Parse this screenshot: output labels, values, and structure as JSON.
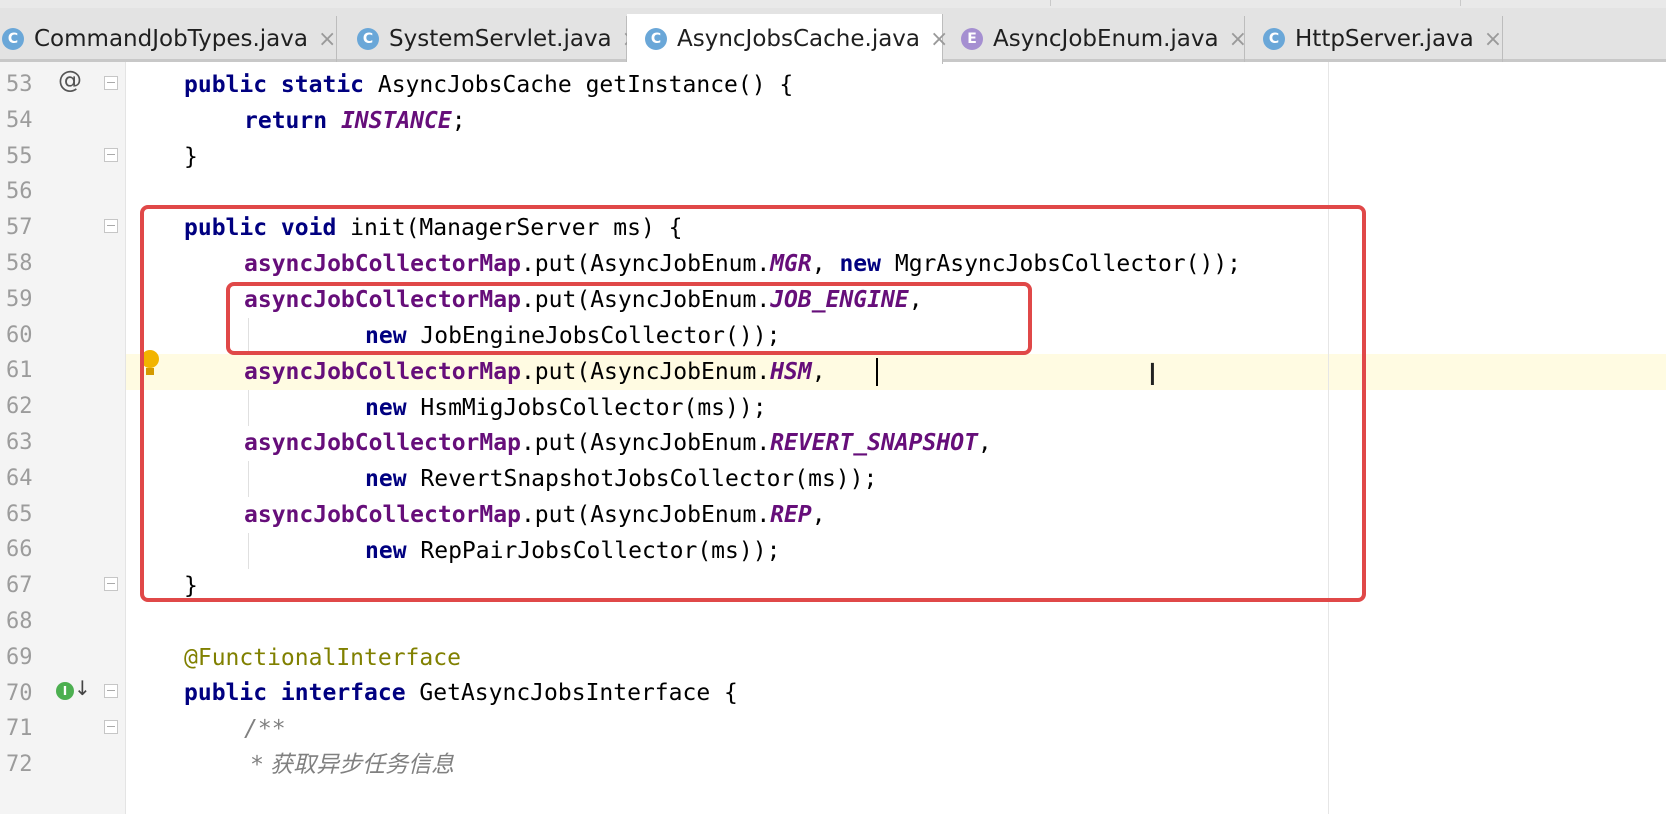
{
  "tabs": [
    {
      "label": "CommandJobTypes.java",
      "icon": "C",
      "active": false
    },
    {
      "label": "SystemServlet.java",
      "icon": "C",
      "active": false
    },
    {
      "label": "AsyncJobsCache.java",
      "icon": "C",
      "active": true
    },
    {
      "label": "AsyncJobEnum.java",
      "icon": "E",
      "active": false
    },
    {
      "label": "HttpServer.java",
      "icon": "C",
      "active": false
    }
  ],
  "tab_close_glyph": "×",
  "line_numbers": [
    "53",
    "54",
    "55",
    "56",
    "57",
    "58",
    "59",
    "60",
    "61",
    "62",
    "63",
    "64",
    "65",
    "66",
    "67",
    "68",
    "69",
    "70",
    "71",
    "72"
  ],
  "gutter_icons": {
    "override": "@",
    "implemented": "I",
    "implemented_arrow": "↓"
  },
  "code": {
    "l53": {
      "kw1": "public static",
      "rest": " AsyncJobsCache getInstance() {"
    },
    "l54": {
      "kw": "return",
      "sp": " ",
      "enum": "INSTANCE",
      "rest": ";"
    },
    "l55": {
      "text": "}"
    },
    "l57": {
      "kw1": "public void",
      "rest": " init(ManagerServer ms) {"
    },
    "l58": {
      "fld": "asyncJobCollectorMap",
      "a": ".put(AsyncJobEnum.",
      "enum": "MGR",
      "b": ", ",
      "kw": "new",
      "c": " MgrAsyncJobsCollector());"
    },
    "l59": {
      "fld": "asyncJobCollectorMap",
      "a": ".put(AsyncJobEnum.",
      "enum": "JOB_ENGINE",
      "b": ","
    },
    "l60": {
      "kw": "new",
      "c": " JobEngineJobsCollector());"
    },
    "l61": {
      "fld": "asyncJobCollectorMap",
      "a": ".put(AsyncJobEnum.",
      "enum": "HSM",
      "b": ","
    },
    "l62": {
      "kw": "new",
      "c": " HsmMigJobsCollector(ms));"
    },
    "l63": {
      "fld": "asyncJobCollectorMap",
      "a": ".put(AsyncJobEnum.",
      "enum": "REVERT_SNAPSHOT",
      "b": ","
    },
    "l64": {
      "kw": "new",
      "c": " RevertSnapshotJobsCollector(ms));"
    },
    "l65": {
      "fld": "asyncJobCollectorMap",
      "a": ".put(AsyncJobEnum.",
      "enum": "REP",
      "b": ","
    },
    "l66": {
      "kw": "new",
      "c": " RepPairJobsCollector(ms));"
    },
    "l67": {
      "text": "}"
    },
    "l69": {
      "ann": "@FunctionalInterface"
    },
    "l70": {
      "kw1": "public interface",
      "rest": " GetAsyncJobsInterface {"
    },
    "l71": {
      "cmt": "/**"
    },
    "l72": {
      "cmt": " * 获取异步任务信息"
    }
  },
  "highlight_color": "#e04848"
}
